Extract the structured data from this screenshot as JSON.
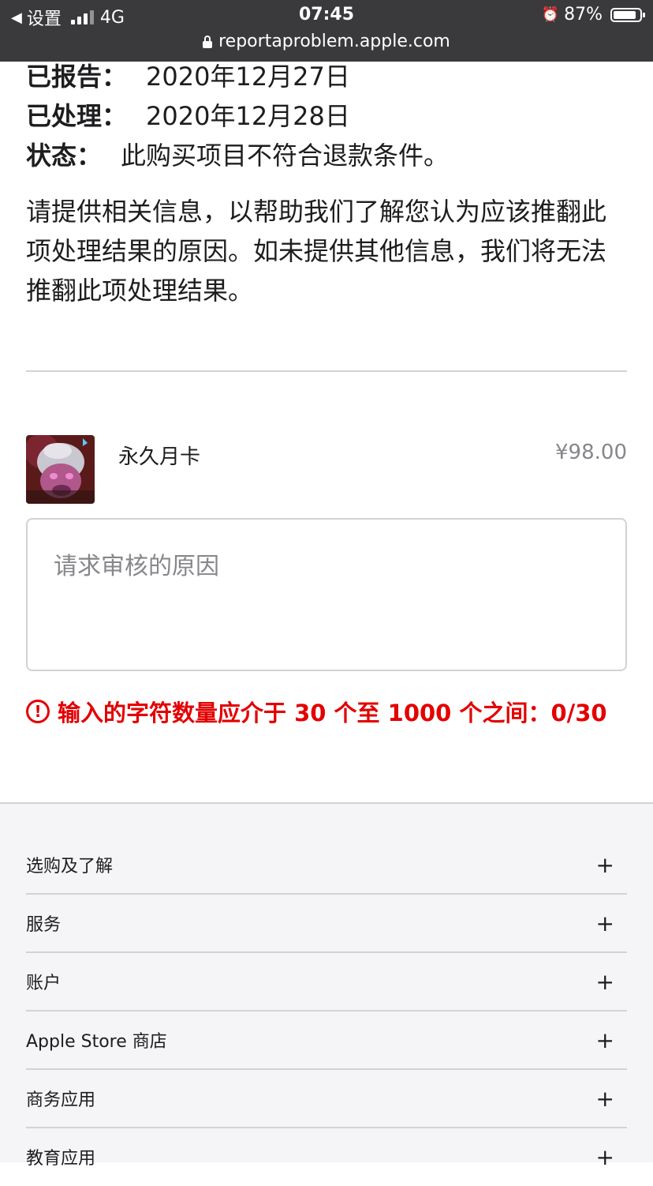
{
  "status_bar": {
    "back_label": "◀",
    "carrier": "设置",
    "network": "4G",
    "time": "07:45",
    "battery": "87%",
    "battery_level": 0.87,
    "url": "reportaproblem.apple.com"
  },
  "details": {
    "reported_label": "已报告：",
    "reported_value": "2020年12月27日",
    "processed_label": "已处理：",
    "processed_value": "2020年12月28日",
    "status_label": "状态：",
    "status_value": "此购买项目不符合退款条件。"
  },
  "instructions": "请提供相关信息，以帮助我们了解您认为应该推翻此项处理结果的原因。如未提供其他信息，我们将无法推翻此项处理结果。",
  "purchase": {
    "name": "永久月卡",
    "price": "¥98.00"
  },
  "reason": {
    "placeholder": "请求审核的原因",
    "value": ""
  },
  "error": {
    "icon": "!",
    "message": "输入的字符数量应介于 30 个至 1000 个之间：0/30"
  },
  "footer": {
    "items": [
      {
        "label": "选购及了解",
        "toggle": "+"
      },
      {
        "label": "服务",
        "toggle": "+"
      },
      {
        "label": "账户",
        "toggle": "+"
      },
      {
        "label": "Apple Store 商店",
        "toggle": "+"
      },
      {
        "label": "商务应用",
        "toggle": "+"
      },
      {
        "label": "教育应用",
        "toggle": "+"
      }
    ]
  },
  "colors": {
    "error": "#e30000",
    "status_bar": "#3a3a3c",
    "footer_bg": "#f5f5f7"
  }
}
